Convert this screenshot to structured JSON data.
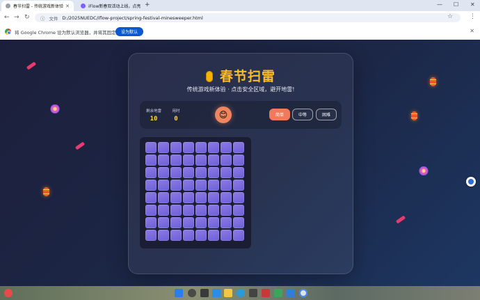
{
  "browser": {
    "tabs": [
      {
        "title": "春节扫雷 - 传统游戏新体验",
        "active": true
      },
      {
        "title": "iFlow新春双活动上线，点亮...",
        "active": false
      }
    ],
    "address_label": "文件",
    "url": "D:/2025NUEDC/iflow-project/spring-festival-minesweeper.html",
    "infobar_message": "将 Google Chrome 设为默认浏览器，并将其固定到任务栏",
    "infobar_button": "设为默认"
  },
  "game": {
    "title": "春节扫雷",
    "subtitle": "传统游戏新体验 · 点击安全区域，避开地雷!",
    "mines_label": "剩余地雷",
    "mines_value": "10",
    "time_label": "用时",
    "time_value": "0",
    "face": "😊",
    "difficulty": {
      "easy": "简单",
      "medium": "中等",
      "hard": "困难",
      "selected": "easy"
    },
    "board": {
      "rows": 8,
      "cols": 8
    }
  },
  "colors": {
    "accent": "#fbbc2a",
    "cell": "#7a6cdf",
    "selected_button": "#f07a5a",
    "stat_value": "#ffd447"
  },
  "icons": [
    "lantern-icon",
    "smiley-icon",
    "firecracker-icon",
    "firework-icon",
    "chrome-logo-icon",
    "windows-start-icon"
  ]
}
